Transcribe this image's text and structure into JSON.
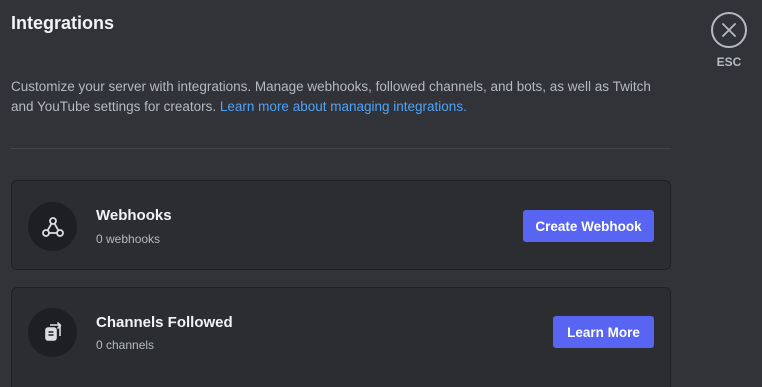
{
  "header": {
    "title": "Integrations",
    "description": "Customize your server with integrations. Manage webhooks, followed channels, and bots, as well as Twitch and YouTube settings for creators.",
    "learn_more_link": "Learn more about managing integrations."
  },
  "close": {
    "icon": "close-icon",
    "label": "ESC"
  },
  "cards": [
    {
      "icon": "webhook-icon",
      "title": "Webhooks",
      "subtitle": "0 webhooks",
      "button_label": "Create Webhook"
    },
    {
      "icon": "channels-followed-icon",
      "title": "Channels Followed",
      "subtitle": "0 channels",
      "button_label": "Learn More"
    }
  ],
  "colors": {
    "background": "#323339",
    "card": "#2b2d31",
    "accent": "#5865f2",
    "link": "#4ea3f8"
  }
}
